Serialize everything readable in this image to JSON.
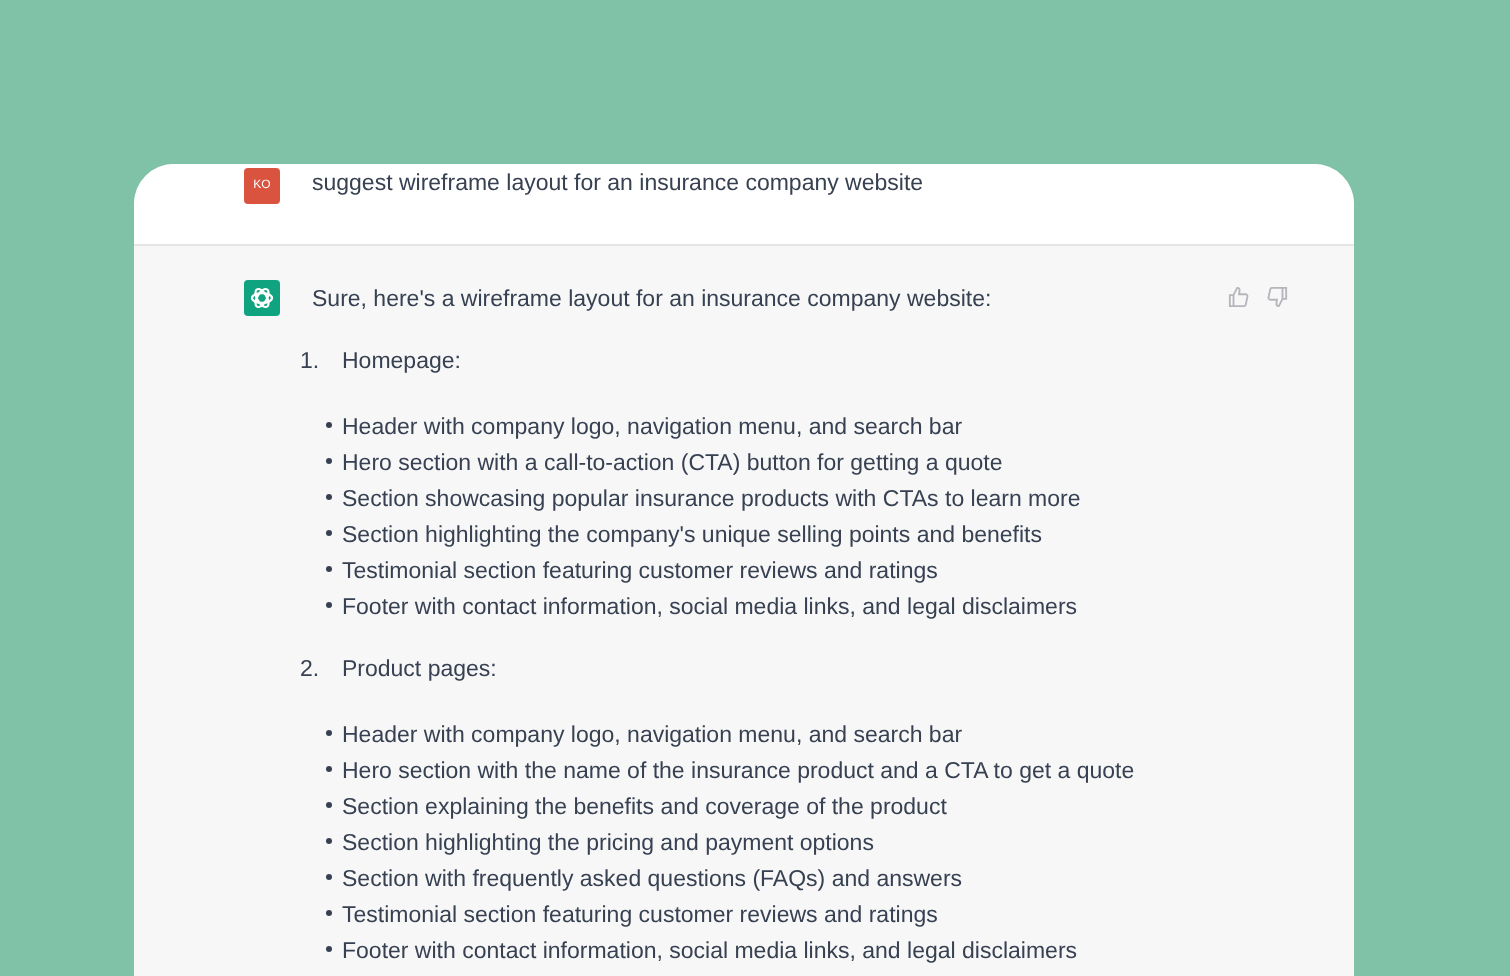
{
  "prompt": {
    "avatar": "KO",
    "text": "suggest wireframe layout for an insurance company website"
  },
  "answer": {
    "intro": "Sure, here's a wireframe layout for an insurance company website:",
    "sections": [
      {
        "number": "1.",
        "title": "Homepage:",
        "items": [
          "Header with company logo, navigation menu, and search bar",
          "Hero section with a call-to-action (CTA) button for getting a quote",
          "Section showcasing popular insurance products with CTAs to learn more",
          "Section highlighting the company's unique selling points and benefits",
          "Testimonial section featuring customer reviews and ratings",
          "Footer with contact information, social media links, and legal disclaimers"
        ]
      },
      {
        "number": "2.",
        "title": "Product pages:",
        "items": [
          "Header with company logo, navigation menu, and search bar",
          "Hero section with the name of the insurance product and a CTA to get a quote",
          "Section explaining the benefits and coverage of the product",
          "Section highlighting the pricing and payment options",
          "Section with frequently asked questions (FAQs) and answers",
          "Testimonial section featuring customer reviews and ratings",
          "Footer with contact information, social media links, and legal disclaimers"
        ]
      }
    ]
  }
}
